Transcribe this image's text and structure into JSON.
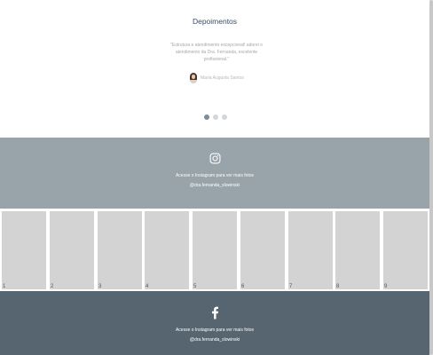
{
  "testimonials": {
    "title": "Depoimentos",
    "quote": "\"Estrutura e atendimento excepcional! adorei o atendimento da Dra. Fernanda, excelente profissional.\"",
    "author": "Maria Augusta Santos",
    "dot_count": 3,
    "active_dot": 0
  },
  "instagram": {
    "icon": "instagram-icon",
    "line1": "Acesse o Instagram para ver mais fotos",
    "handle": "@dra.fernanda_slowinski"
  },
  "gallery": {
    "tiles": [
      "1",
      "2",
      "3",
      "4",
      "5",
      "6",
      "7",
      "8",
      "9"
    ]
  },
  "facebook": {
    "icon": "facebook-icon",
    "line1": "Acesse o Instagram para ver mais fotos",
    "handle": "@dra.fernanda_slowinski"
  },
  "colors": {
    "title": "#3b4c5f",
    "instagram_band": "#98a3aa",
    "footer_band": "#566570",
    "tile": "#d3d3d3",
    "dot_active": "#7e8b98",
    "dot": "#d3d6d9"
  }
}
